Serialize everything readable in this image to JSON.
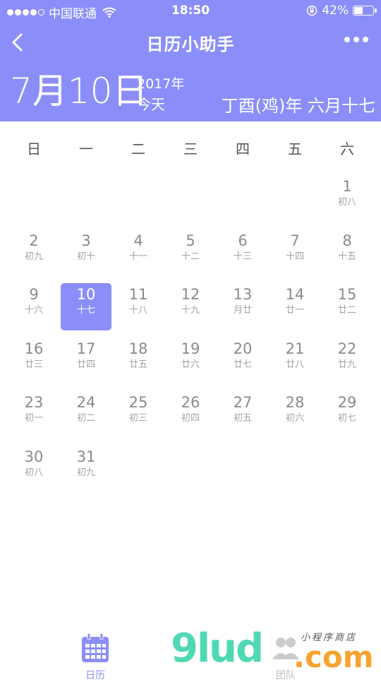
{
  "status_bar": {
    "carrier": "中国联通",
    "time": "18:50",
    "battery": "42%"
  },
  "navbar": {
    "title": "日历小助手"
  },
  "header": {
    "date": "7月10日",
    "year": "2017年",
    "today": "今天",
    "lunar": "丁酉(鸡)年 六月十七"
  },
  "weekdays": [
    "日",
    "一",
    "二",
    "三",
    "四",
    "五",
    "六"
  ],
  "calendar": {
    "selected_day": "10",
    "rows": [
      [
        null,
        null,
        null,
        null,
        null,
        null,
        {
          "day": "1",
          "lunar": "初八"
        }
      ],
      [
        {
          "day": "2",
          "lunar": "初九"
        },
        {
          "day": "3",
          "lunar": "初十"
        },
        {
          "day": "4",
          "lunar": "十一"
        },
        {
          "day": "5",
          "lunar": "十二"
        },
        {
          "day": "6",
          "lunar": "十三"
        },
        {
          "day": "7",
          "lunar": "十四"
        },
        {
          "day": "8",
          "lunar": "十五"
        }
      ],
      [
        {
          "day": "9",
          "lunar": "十六"
        },
        {
          "day": "10",
          "lunar": "十七"
        },
        {
          "day": "11",
          "lunar": "十八"
        },
        {
          "day": "12",
          "lunar": "十九"
        },
        {
          "day": "13",
          "lunar": "月廿"
        },
        {
          "day": "14",
          "lunar": "廿一"
        },
        {
          "day": "15",
          "lunar": "廿二"
        }
      ],
      [
        {
          "day": "16",
          "lunar": "廿三"
        },
        {
          "day": "17",
          "lunar": "廿四"
        },
        {
          "day": "18",
          "lunar": "廿五"
        },
        {
          "day": "19",
          "lunar": "廿六"
        },
        {
          "day": "20",
          "lunar": "廿七"
        },
        {
          "day": "21",
          "lunar": "廿八"
        },
        {
          "day": "22",
          "lunar": "廿九"
        }
      ],
      [
        {
          "day": "23",
          "lunar": "初一"
        },
        {
          "day": "24",
          "lunar": "初二"
        },
        {
          "day": "25",
          "lunar": "初三"
        },
        {
          "day": "26",
          "lunar": "初四"
        },
        {
          "day": "27",
          "lunar": "初五"
        },
        {
          "day": "28",
          "lunar": "初六"
        },
        {
          "day": "29",
          "lunar": "初七"
        }
      ],
      [
        {
          "day": "30",
          "lunar": "初八"
        },
        {
          "day": "31",
          "lunar": "初九"
        },
        null,
        null,
        null,
        null,
        null
      ]
    ]
  },
  "tabbar": {
    "calendar_label": "日历",
    "team_label": "团队"
  },
  "watermark": {
    "brand_a": "9lud",
    "brand_b": ".com",
    "tagline": "小程序商店"
  },
  "colors": {
    "accent": "#8b8ef9"
  }
}
